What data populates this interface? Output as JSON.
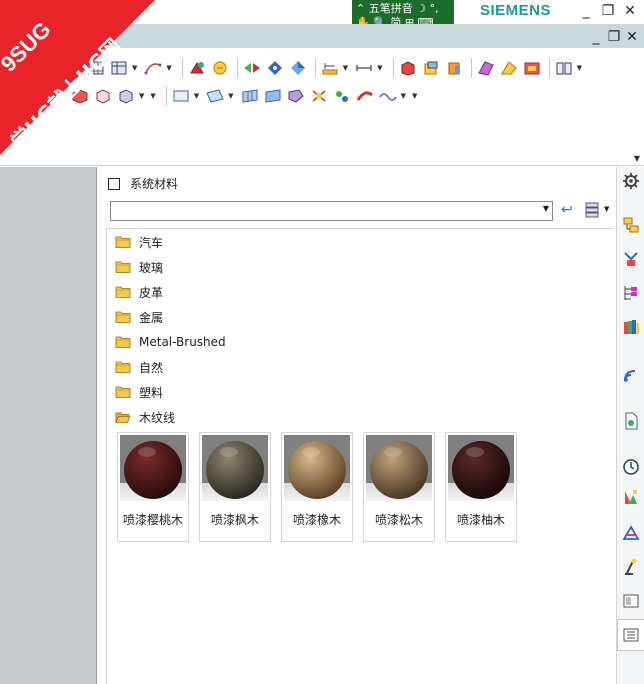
{
  "titlebar": {
    "brand": "SIEMENS",
    "minimize": "_",
    "restore": "❐",
    "close": "✕"
  },
  "ime": {
    "row1": "⌃ 五笔拼音 ☽ °,",
    "row2": "✋ 🔍 简 ⊞ ⌨"
  },
  "menubar": {
    "minimize": "_",
    "restore": "❐",
    "close": "✕"
  },
  "watermark": {
    "line1": "9SUG",
    "line2": "学UG就上UG网"
  },
  "panel": {
    "title": "系统材料",
    "path_value": "",
    "back_icon": "↩",
    "folders": [
      {
        "label": "汽车",
        "open": false
      },
      {
        "label": "玻璃",
        "open": false
      },
      {
        "label": "皮革",
        "open": false
      },
      {
        "label": "金属",
        "open": false
      },
      {
        "label": "Metal-Brushed",
        "open": false
      },
      {
        "label": "自然",
        "open": false
      },
      {
        "label": "塑料",
        "open": false
      },
      {
        "label": "木纹线",
        "open": true
      }
    ],
    "materials": [
      {
        "label": "喷漆樱桃木",
        "color_light": "#7a2c2c",
        "color_dark": "#2a0b0b"
      },
      {
        "label": "喷漆枫木",
        "color_light": "#8c8670",
        "color_dark": "#2c2a22"
      },
      {
        "label": "喷漆橡木",
        "color_light": "#d8b88a",
        "color_dark": "#5d4428"
      },
      {
        "label": "喷漆松木",
        "color_light": "#bfa27a",
        "color_dark": "#4a3a28"
      },
      {
        "label": "喷漆柚木",
        "color_light": "#5a2a28",
        "color_dark": "#1a0808"
      }
    ]
  },
  "colors": {
    "accent": "#1a9a9a",
    "folder": "#f2c94c",
    "ime_bg": "#1d6b2a"
  }
}
